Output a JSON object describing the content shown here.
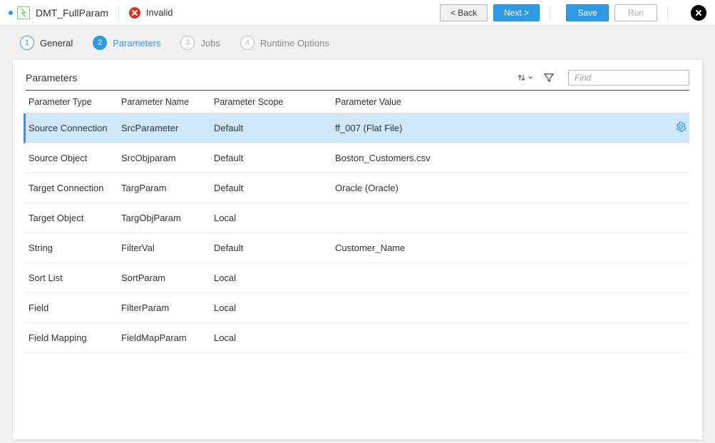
{
  "header": {
    "title": "DMT_FullParam",
    "status_label": "Invalid",
    "back_label": "< Back",
    "next_label": "Next >",
    "save_label": "Save",
    "run_label": "Run"
  },
  "wizard": {
    "step1_num": "1",
    "step1_label": "General",
    "step2_num": "2",
    "step2_label": "Parameters",
    "step3_num": "3",
    "step3_label": "Jobs",
    "step4_num": "4",
    "step4_label": "Runtime Options"
  },
  "panel": {
    "title": "Parameters",
    "find_placeholder": "Find",
    "columns": {
      "type": "Parameter Type",
      "name": "Parameter Name",
      "scope": "Parameter Scope",
      "value": "Parameter Value"
    },
    "rows": [
      {
        "type": "Source Connection",
        "name": "SrcParameter",
        "scope": "Default",
        "value": "ff_007 (Flat File)",
        "selected": true
      },
      {
        "type": "Source Object",
        "name": "SrcObjparam",
        "scope": "Default",
        "value": "Boston_Customers.csv",
        "selected": false
      },
      {
        "type": "Target Connection",
        "name": "TargParam",
        "scope": "Default",
        "value": "Oracle (Oracle)",
        "selected": false
      },
      {
        "type": "Target Object",
        "name": "TargObjParam",
        "scope": "Local",
        "value": "",
        "selected": false
      },
      {
        "type": "String",
        "name": "FilterVal",
        "scope": "Default",
        "value": "Customer_Name",
        "selected": false
      },
      {
        "type": "Sort List",
        "name": "SortParam",
        "scope": "Local",
        "value": "",
        "selected": false
      },
      {
        "type": "Field",
        "name": "FilterParam",
        "scope": "Local",
        "value": "",
        "selected": false
      },
      {
        "type": "Field Mapping",
        "name": "FieldMapParam",
        "scope": "Local",
        "value": "",
        "selected": false
      }
    ]
  }
}
